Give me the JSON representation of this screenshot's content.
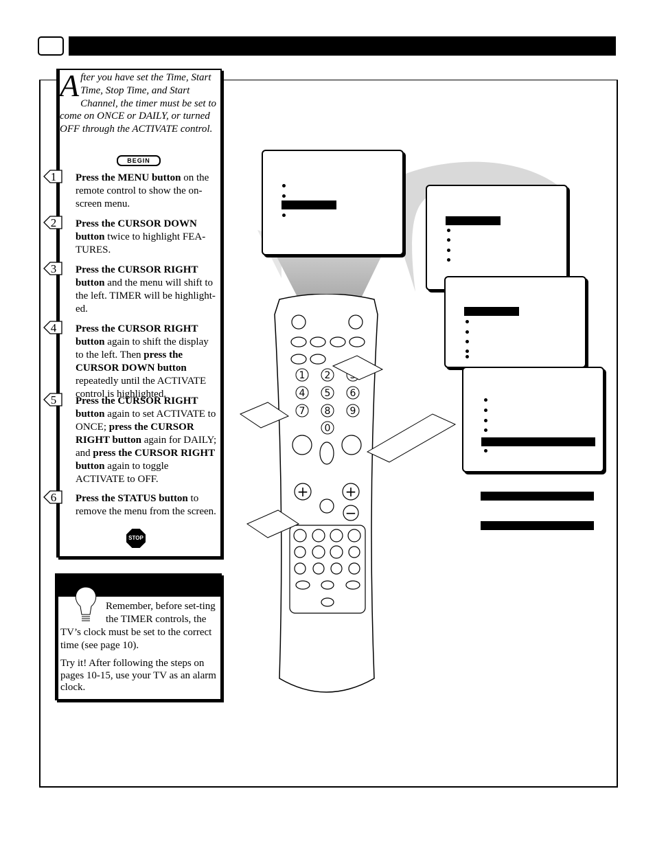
{
  "intro": {
    "drop_cap": "A",
    "text": "fter you have set the Time, Start Time, Stop Time, and Start Channel, the timer must be set to come on ONCE or DAILY,  or turned OFF through the ACTIVATE control."
  },
  "begin_label": "BEGIN",
  "steps": [
    {
      "num": "1",
      "segments": [
        {
          "t": "Press the MENU button",
          "b": true
        },
        {
          "t": " on the remote control to show the on-screen menu.",
          "b": false
        }
      ]
    },
    {
      "num": "2",
      "segments": [
        {
          "t": "Press the CURSOR DOWN button",
          "b": true
        },
        {
          "t": " twice to highlight FEA-TURES.",
          "b": false
        }
      ]
    },
    {
      "num": "3",
      "segments": [
        {
          "t": "Press the CURSOR RIGHT button",
          "b": true
        },
        {
          "t": " and the menu will shift to the left. TIMER will be highlight-ed.",
          "b": false
        }
      ]
    },
    {
      "num": "4",
      "segments": [
        {
          "t": "Press the CURSOR RIGHT button",
          "b": true
        },
        {
          "t": " again to shift the display to the left. Then ",
          "b": false
        },
        {
          "t": "press the CURSOR DOWN button",
          "b": true
        },
        {
          "t": " repeatedly until the ACTIVATE control is highlighted.",
          "b": false
        }
      ]
    },
    {
      "num": "5",
      "segments": [
        {
          "t": "Press the CURSOR RIGHT button",
          "b": true
        },
        {
          "t": " again to set ACTIVATE to ONCE; ",
          "b": false
        },
        {
          "t": "press the CURSOR RIGHT button",
          "b": true
        },
        {
          "t": " again for DAILY; and ",
          "b": false
        },
        {
          "t": "press the CURSOR RIGHT button",
          "b": true
        },
        {
          "t": " again to toggle ACTIVATE to OFF.",
          "b": false
        }
      ]
    },
    {
      "num": "6",
      "segments": [
        {
          "t": "Press the STATUS button",
          "b": true
        },
        {
          "t": " to remove the menu from the screen.",
          "b": false
        }
      ]
    }
  ],
  "stop_label": "STOP",
  "tip": {
    "p1": "Remember, before set-ting the TIMER controls, the TV’s clock must be set to the correct time (see page 10).",
    "p2": "Try it! After following the steps on pages 10-15, use your TV as an alarm clock."
  },
  "remote_digits": [
    "1",
    "2",
    "3",
    "4",
    "5",
    "6",
    "7",
    "8",
    "9",
    "0"
  ],
  "colors": {
    "ink": "#000000",
    "shade": "#d9d9d9"
  }
}
